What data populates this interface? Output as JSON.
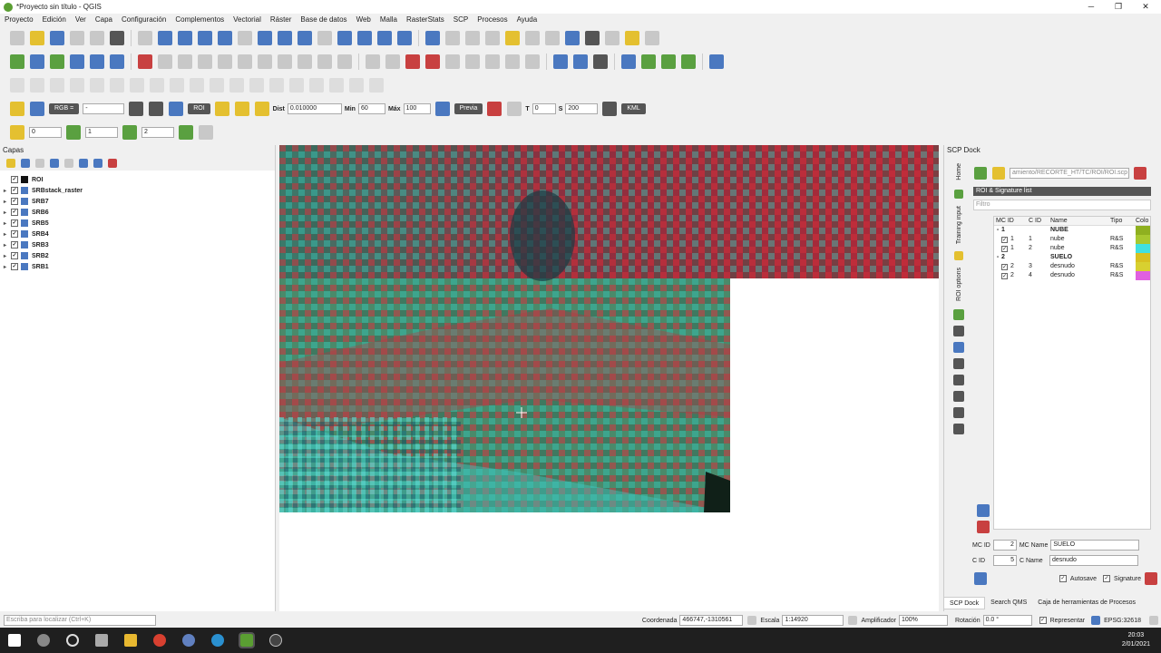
{
  "window": {
    "title": "*Proyecto sin título - QGIS",
    "minimize": "─",
    "restore": "❐",
    "close": "✕"
  },
  "menu": [
    "Proyecto",
    "Edición",
    "Ver",
    "Capa",
    "Configuración",
    "Complementos",
    "Vectorial",
    "Ráster",
    "Base de datos",
    "Web",
    "Malla",
    "RasterStats",
    "SCP",
    "Procesos",
    "Ayuda"
  ],
  "scp_toolbar": {
    "rgb_label": "RGB =",
    "rgb_value": "-",
    "roi_button": "ROI",
    "dist_label": "Dist",
    "dist_value": "0.010000",
    "min_label": "Min",
    "min_value": "60",
    "max_label": "Máx",
    "max_value": "100",
    "preview_button": "Previa",
    "t_label": "T",
    "t_value": "0",
    "s_label": "S",
    "s_value": "200",
    "kml_label": "KML"
  },
  "band_toolbar": {
    "band1": "0",
    "band2": "1",
    "band3": "2"
  },
  "layers_panel": {
    "title": "Capas",
    "layers": [
      {
        "name": "ROI",
        "checked": true,
        "type": "roi"
      },
      {
        "name": "SRBstack_raster",
        "checked": true,
        "type": "raster"
      },
      {
        "name": "SRB7",
        "checked": true,
        "type": "raster"
      },
      {
        "name": "SRB6",
        "checked": true,
        "type": "raster"
      },
      {
        "name": "SRB5",
        "checked": true,
        "type": "raster"
      },
      {
        "name": "SRB4",
        "checked": true,
        "type": "raster"
      },
      {
        "name": "SRB3",
        "checked": true,
        "type": "raster"
      },
      {
        "name": "SRB2",
        "checked": true,
        "type": "raster"
      },
      {
        "name": "SRB1",
        "checked": true,
        "type": "raster"
      }
    ]
  },
  "scp_dock": {
    "title": "SCP Dock",
    "tabs_vertical": [
      "Home",
      "Training input",
      "ROI options"
    ],
    "file_path": "amiento/RECORTE_HT/TC/ROI/ROI.scp",
    "section_title": "ROI & Signature list",
    "filter_placeholder": "Filtro",
    "columns": [
      "MC ID",
      "C ID",
      "Name",
      "Tipo",
      "Colo"
    ],
    "rows": [
      {
        "kind": "group",
        "mc": "1",
        "cid": "",
        "name": "NUBE",
        "tipo": "",
        "color": "#8fb020"
      },
      {
        "kind": "item",
        "mc": "1",
        "cid": "1",
        "name": "nube",
        "tipo": "R&S",
        "color": "#a8c830"
      },
      {
        "kind": "item",
        "mc": "1",
        "cid": "2",
        "name": "nube",
        "tipo": "R&S",
        "color": "#40e0e0"
      },
      {
        "kind": "group",
        "mc": "2",
        "cid": "",
        "name": "SUELO",
        "tipo": "",
        "color": "#d8c020"
      },
      {
        "kind": "item",
        "mc": "2",
        "cid": "3",
        "name": "desnudo",
        "tipo": "R&S",
        "color": "#d8d030"
      },
      {
        "kind": "item",
        "mc": "2",
        "cid": "4",
        "name": "desnudo",
        "tipo": "R&S",
        "color": "#e060e0"
      }
    ],
    "mc_id_label": "MC ID",
    "mc_id_value": "2",
    "mc_name_label": "MC Name",
    "mc_name_value": "SUELO",
    "c_id_label": "C ID",
    "c_id_value": "5",
    "c_name_label": "C Name",
    "c_name_value": "desnudo",
    "autosave_label": "Autosave",
    "signature_label": "Signature",
    "bottom_tabs": [
      "SCP Dock",
      "Search QMS",
      "Caja de herramientas de Procesos"
    ]
  },
  "status": {
    "search_placeholder": "Escriba para localizar (Ctrl+K)",
    "coord_label": "Coordenada",
    "coord_value": "466747,-1310561",
    "scale_label": "Escala",
    "scale_value": "1:14920",
    "magnifier_label": "Amplificador",
    "magnifier_value": "100%",
    "rotation_label": "Rotación",
    "rotation_value": "0.0 °",
    "render_label": "Representar",
    "crs": "EPSG:32618"
  },
  "taskbar": {
    "time": "20:03",
    "date": "2/01/2021"
  }
}
